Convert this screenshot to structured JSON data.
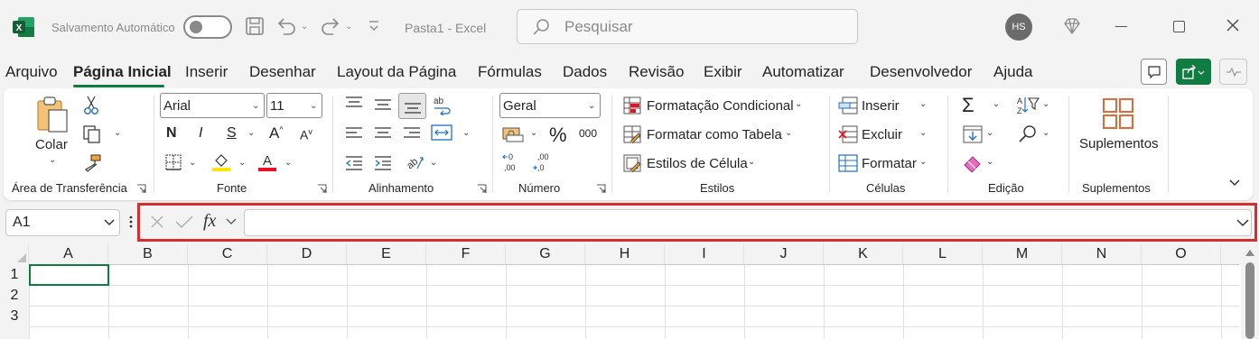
{
  "titlebar": {
    "autosave_label": "Salvamento Automático",
    "doc_title": "Pasta1",
    "separator": " - ",
    "app_name": "Excel",
    "search_placeholder": "Pesquisar",
    "avatar_initials": "HS"
  },
  "menu": {
    "tabs": [
      "Arquivo",
      "Página Inicial",
      "Inserir",
      "Desenhar",
      "Layout da Página",
      "Fórmulas",
      "Dados",
      "Revisão",
      "Exibir",
      "Automatizar",
      "Desenvolvedor",
      "Ajuda"
    ],
    "active_tab": "Página Inicial"
  },
  "ribbon": {
    "clipboard": {
      "paste_label": "Colar",
      "group_label": "Área de Transferência"
    },
    "font": {
      "font_name": "Arial",
      "font_size": "11",
      "bold": "N",
      "italic": "I",
      "underline": "S",
      "group_label": "Fonte"
    },
    "alignment": {
      "group_label": "Alinhamento"
    },
    "number": {
      "format": "Geral",
      "percent": "%",
      "thousands": "000",
      "group_label": "Número"
    },
    "styles": {
      "conditional_formatting": "Formatação Condicional",
      "format_as_table": "Formatar como Tabela",
      "cell_styles": "Estilos de Célula",
      "group_label": "Estilos"
    },
    "cells": {
      "insert": "Inserir",
      "delete": "Excluir",
      "format": "Formatar",
      "group_label": "Células"
    },
    "editing": {
      "group_label": "Edição"
    },
    "addins": {
      "button_label": "Suplementos",
      "group_label": "Suplementos"
    }
  },
  "formula_bar": {
    "name_box": "A1",
    "fx": "fx",
    "formula": ""
  },
  "sheet": {
    "columns": [
      "A",
      "B",
      "C",
      "D",
      "E",
      "F",
      "G",
      "H",
      "I",
      "J",
      "K",
      "L",
      "M",
      "N",
      "O"
    ],
    "rows": [
      "1",
      "2",
      "3"
    ]
  },
  "colors": {
    "accent_green": "#107c41",
    "highlight_red": "#d32f2f",
    "font_color_red": "#e81123",
    "highlight_yellow": "#ffe600"
  }
}
